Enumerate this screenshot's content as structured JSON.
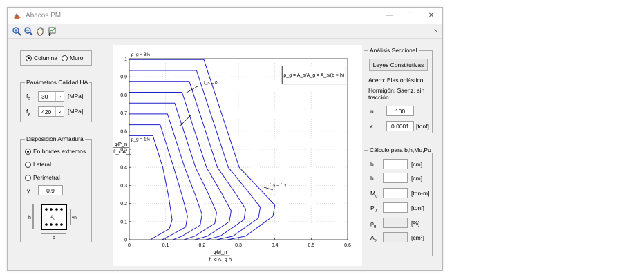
{
  "window": {
    "title": "Abacos PM"
  },
  "toolbar": {
    "icons": [
      "zoom-in-icon",
      "zoom-out-icon",
      "pan-hand-icon",
      "data-cursor-icon"
    ]
  },
  "element_type": {
    "options": [
      {
        "label": "Columna",
        "selected": true
      },
      {
        "label": "Muro",
        "selected": false
      }
    ]
  },
  "params": {
    "title": "Parámetros Calidad HA",
    "fc": {
      "label": "f",
      "sub": "c",
      "value": "30",
      "unit": "[MPa]"
    },
    "fy": {
      "label": "f",
      "sub": "y",
      "value": "420",
      "unit": "[MPa]"
    }
  },
  "armadura": {
    "title": "Disposición Armadura",
    "options": [
      {
        "label": "En bordes extremos",
        "selected": true
      },
      {
        "label": "Lateral",
        "selected": false
      },
      {
        "label": "Perimetral",
        "selected": false
      }
    ],
    "gamma_symbol": "γ",
    "gamma_value": "0.9",
    "sketch": {
      "h": "h",
      "b": "b",
      "ag": "A",
      "ag_sub": "g",
      "gh": "γh"
    }
  },
  "analisis": {
    "title": "Análisis Seccional",
    "button": "Leyes Constitutivas",
    "acero": "Acero: Elastoplástico",
    "hormigon": "Hormigón: Saenz, sin tracción",
    "n": {
      "label": "n",
      "value": "100"
    },
    "eps": {
      "label": "ϵ",
      "value": "0.0001",
      "unit": "[tonf]"
    }
  },
  "calculo": {
    "title": "Cálculo para b,h,Mu,Pu",
    "rows": [
      {
        "label": "b",
        "sub": "",
        "unit": "[cm]",
        "disabled": false
      },
      {
        "label": "h",
        "sub": "",
        "unit": "[cm]",
        "disabled": false
      },
      {
        "label": "M",
        "sub": "u",
        "unit": "[ton-m]",
        "disabled": false
      },
      {
        "label": "P",
        "sub": "u",
        "unit": "[tonf]",
        "disabled": false
      },
      {
        "label": "ρ",
        "sub": "g",
        "unit": "[%]",
        "disabled": true
      },
      {
        "label": "A",
        "sub": "s",
        "unit": "[cm²]",
        "disabled": true
      }
    ]
  },
  "chart_data": {
    "type": "line",
    "xlabel": "φM_n / f'_c A_g h",
    "ylabel": "φP_n / f'_c A_g",
    "xlim": [
      0,
      0.6
    ],
    "ylim": [
      0,
      1
    ],
    "xticks": [
      "0",
      "0.1",
      "0.2",
      "0.3",
      "0.4",
      "0.5",
      "0.6"
    ],
    "yticks": [
      "0",
      "0.1",
      "0.2",
      "0.3",
      "0.4",
      "0.5",
      "0.6",
      "0.7",
      "0.8",
      "0.9",
      "1"
    ],
    "grid": true,
    "annotations": {
      "rho_max": "ρ_g = 8%",
      "rho_min": "ρ_g = 1%",
      "fs0": "f_s = 0",
      "fsfy": "f_s = f_y",
      "formula": "ρ_g = A_s/A_g = A_s/(b × h)"
    },
    "series": [
      {
        "values": [
          [
            0,
            0.575
          ],
          [
            0.065,
            0.575
          ],
          [
            0.092,
            0.4
          ],
          [
            0.108,
            0.24
          ],
          [
            0.118,
            0.11
          ],
          [
            0.11,
            0.06
          ],
          [
            0.075,
            0.02
          ],
          [
            0.058,
            0
          ]
        ]
      },
      {
        "values": [
          [
            0,
            0.635
          ],
          [
            0.085,
            0.635
          ],
          [
            0.122,
            0.4
          ],
          [
            0.145,
            0.245
          ],
          [
            0.16,
            0.13
          ],
          [
            0.155,
            0.07
          ],
          [
            0.11,
            0.02
          ],
          [
            0.09,
            0
          ]
        ]
      },
      {
        "values": [
          [
            0,
            0.695
          ],
          [
            0.105,
            0.695
          ],
          [
            0.152,
            0.4
          ],
          [
            0.181,
            0.25
          ],
          [
            0.2,
            0.14
          ],
          [
            0.195,
            0.08
          ],
          [
            0.145,
            0.02
          ],
          [
            0.12,
            0
          ]
        ]
      },
      {
        "values": [
          [
            0,
            0.755
          ],
          [
            0.125,
            0.755
          ],
          [
            0.182,
            0.4
          ],
          [
            0.217,
            0.255
          ],
          [
            0.24,
            0.15
          ],
          [
            0.235,
            0.09
          ],
          [
            0.18,
            0.02
          ],
          [
            0.15,
            0
          ]
        ]
      },
      {
        "values": [
          [
            0,
            0.815
          ],
          [
            0.145,
            0.815
          ],
          [
            0.212,
            0.4
          ],
          [
            0.253,
            0.26
          ],
          [
            0.28,
            0.16
          ],
          [
            0.275,
            0.1
          ],
          [
            0.215,
            0.02
          ],
          [
            0.18,
            0
          ]
        ]
      },
      {
        "values": [
          [
            0,
            0.875
          ],
          [
            0.165,
            0.875
          ],
          [
            0.242,
            0.4
          ],
          [
            0.289,
            0.265
          ],
          [
            0.32,
            0.17
          ],
          [
            0.315,
            0.11
          ],
          [
            0.25,
            0.02
          ],
          [
            0.21,
            0
          ]
        ]
      },
      {
        "values": [
          [
            0,
            0.935
          ],
          [
            0.185,
            0.935
          ],
          [
            0.272,
            0.4
          ],
          [
            0.325,
            0.27
          ],
          [
            0.36,
            0.18
          ],
          [
            0.355,
            0.12
          ],
          [
            0.285,
            0.02
          ],
          [
            0.24,
            0
          ]
        ]
      },
      {
        "values": [
          [
            0,
            0.995
          ],
          [
            0.205,
            0.995
          ],
          [
            0.302,
            0.4
          ],
          [
            0.361,
            0.275
          ],
          [
            0.4,
            0.19
          ],
          [
            0.395,
            0.13
          ],
          [
            0.32,
            0.02
          ],
          [
            0.27,
            0
          ]
        ]
      }
    ]
  }
}
